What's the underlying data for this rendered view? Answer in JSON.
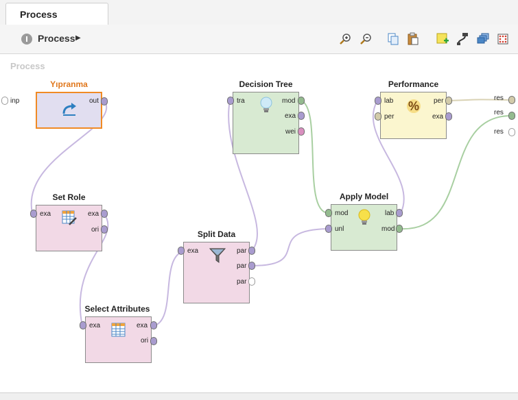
{
  "tab": {
    "label": "Process"
  },
  "breadcrumb": {
    "label": "Process"
  },
  "canvas": {
    "title": "Process"
  },
  "process_ports": {
    "input": "inp",
    "outputs": [
      "res",
      "res",
      "res"
    ]
  },
  "operators": {
    "ypranma": {
      "title": "Yıpranma",
      "out": [
        "out"
      ]
    },
    "set_role": {
      "title": "Set Role",
      "in": [
        "exa"
      ],
      "out": [
        "exa",
        "ori"
      ]
    },
    "select_attributes": {
      "title": "Select Attributes",
      "in": [
        "exa"
      ],
      "out": [
        "exa",
        "ori"
      ]
    },
    "split_data": {
      "title": "Split Data",
      "in": [
        "exa"
      ],
      "out": [
        "par",
        "par",
        "par"
      ]
    },
    "decision_tree": {
      "title": "Decision Tree",
      "in": [
        "tra"
      ],
      "out": [
        "mod",
        "exa",
        "wei"
      ]
    },
    "apply_model": {
      "title": "Apply Model",
      "in": [
        "mod",
        "unl"
      ],
      "out": [
        "lab",
        "mod"
      ]
    },
    "performance": {
      "title": "Performance",
      "in": [
        "lab",
        "per"
      ],
      "out": [
        "per",
        "exa"
      ]
    }
  },
  "colors": {
    "port_example": "#a99ccf",
    "port_model": "#94bb8f",
    "port_weights": "#d98fbf",
    "port_perf": "#d2cbaa",
    "wire_example": "#c7b8e0",
    "wire_model": "#a8cfa1",
    "wire_perf": "#d9d2b4"
  }
}
